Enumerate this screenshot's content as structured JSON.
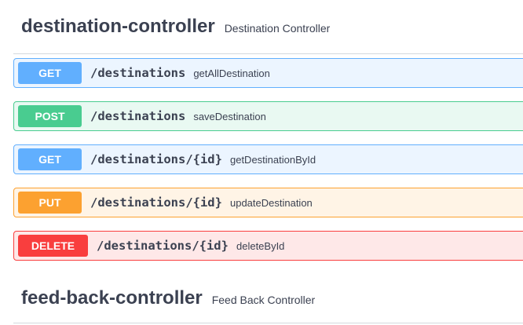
{
  "sections": [
    {
      "title": "destination-controller",
      "description": "Destination Controller"
    },
    {
      "title": "feed-back-controller",
      "description": "Feed Back Controller"
    }
  ],
  "operations": [
    {
      "method": "GET",
      "path": "/destinations",
      "summary": "getAllDestination"
    },
    {
      "method": "POST",
      "path": "/destinations",
      "summary": "saveDestination"
    },
    {
      "method": "GET",
      "path": "/destinations/{id}",
      "summary": "getDestinationById"
    },
    {
      "method": "PUT",
      "path": "/destinations/{id}",
      "summary": "updateDestination"
    },
    {
      "method": "DELETE",
      "path": "/destinations/{id}",
      "summary": "deleteById"
    }
  ],
  "colors": {
    "get": "#61affe",
    "post": "#49cc90",
    "put": "#fca130",
    "delete": "#f93e3e",
    "text": "#3b4151"
  }
}
